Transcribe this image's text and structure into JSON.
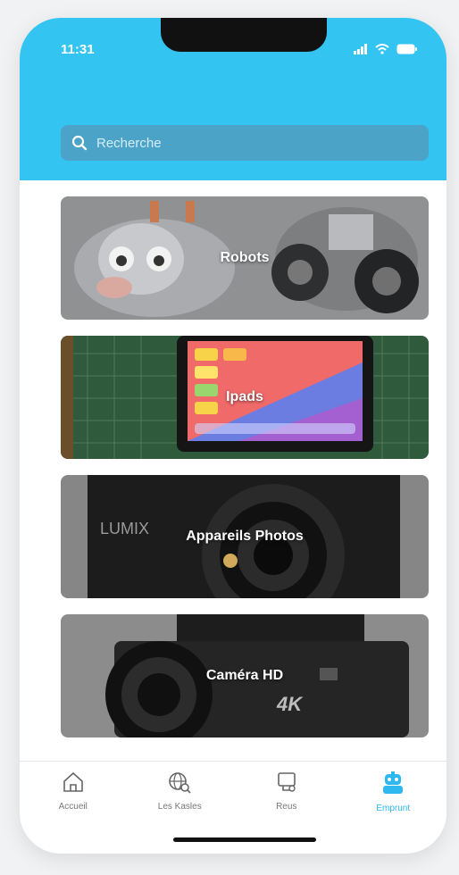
{
  "status_bar": {
    "time": "11:31"
  },
  "search": {
    "placeholder": "Recherche"
  },
  "categories": [
    {
      "label": "Robots"
    },
    {
      "label": "Ipads"
    },
    {
      "label": "Appareils Photos"
    },
    {
      "label": "Caméra HD"
    }
  ],
  "tabbar": {
    "items": [
      {
        "label": "Accueil",
        "icon": "home-icon"
      },
      {
        "label": "Les Kasles",
        "icon": "globe-search-icon"
      },
      {
        "label": "Reus",
        "icon": "device-icon"
      },
      {
        "label": "Emprunt",
        "icon": "robot-icon",
        "active": true
      }
    ]
  },
  "colors": {
    "header": "#33c4f2",
    "accent": "#2fb8ef"
  }
}
